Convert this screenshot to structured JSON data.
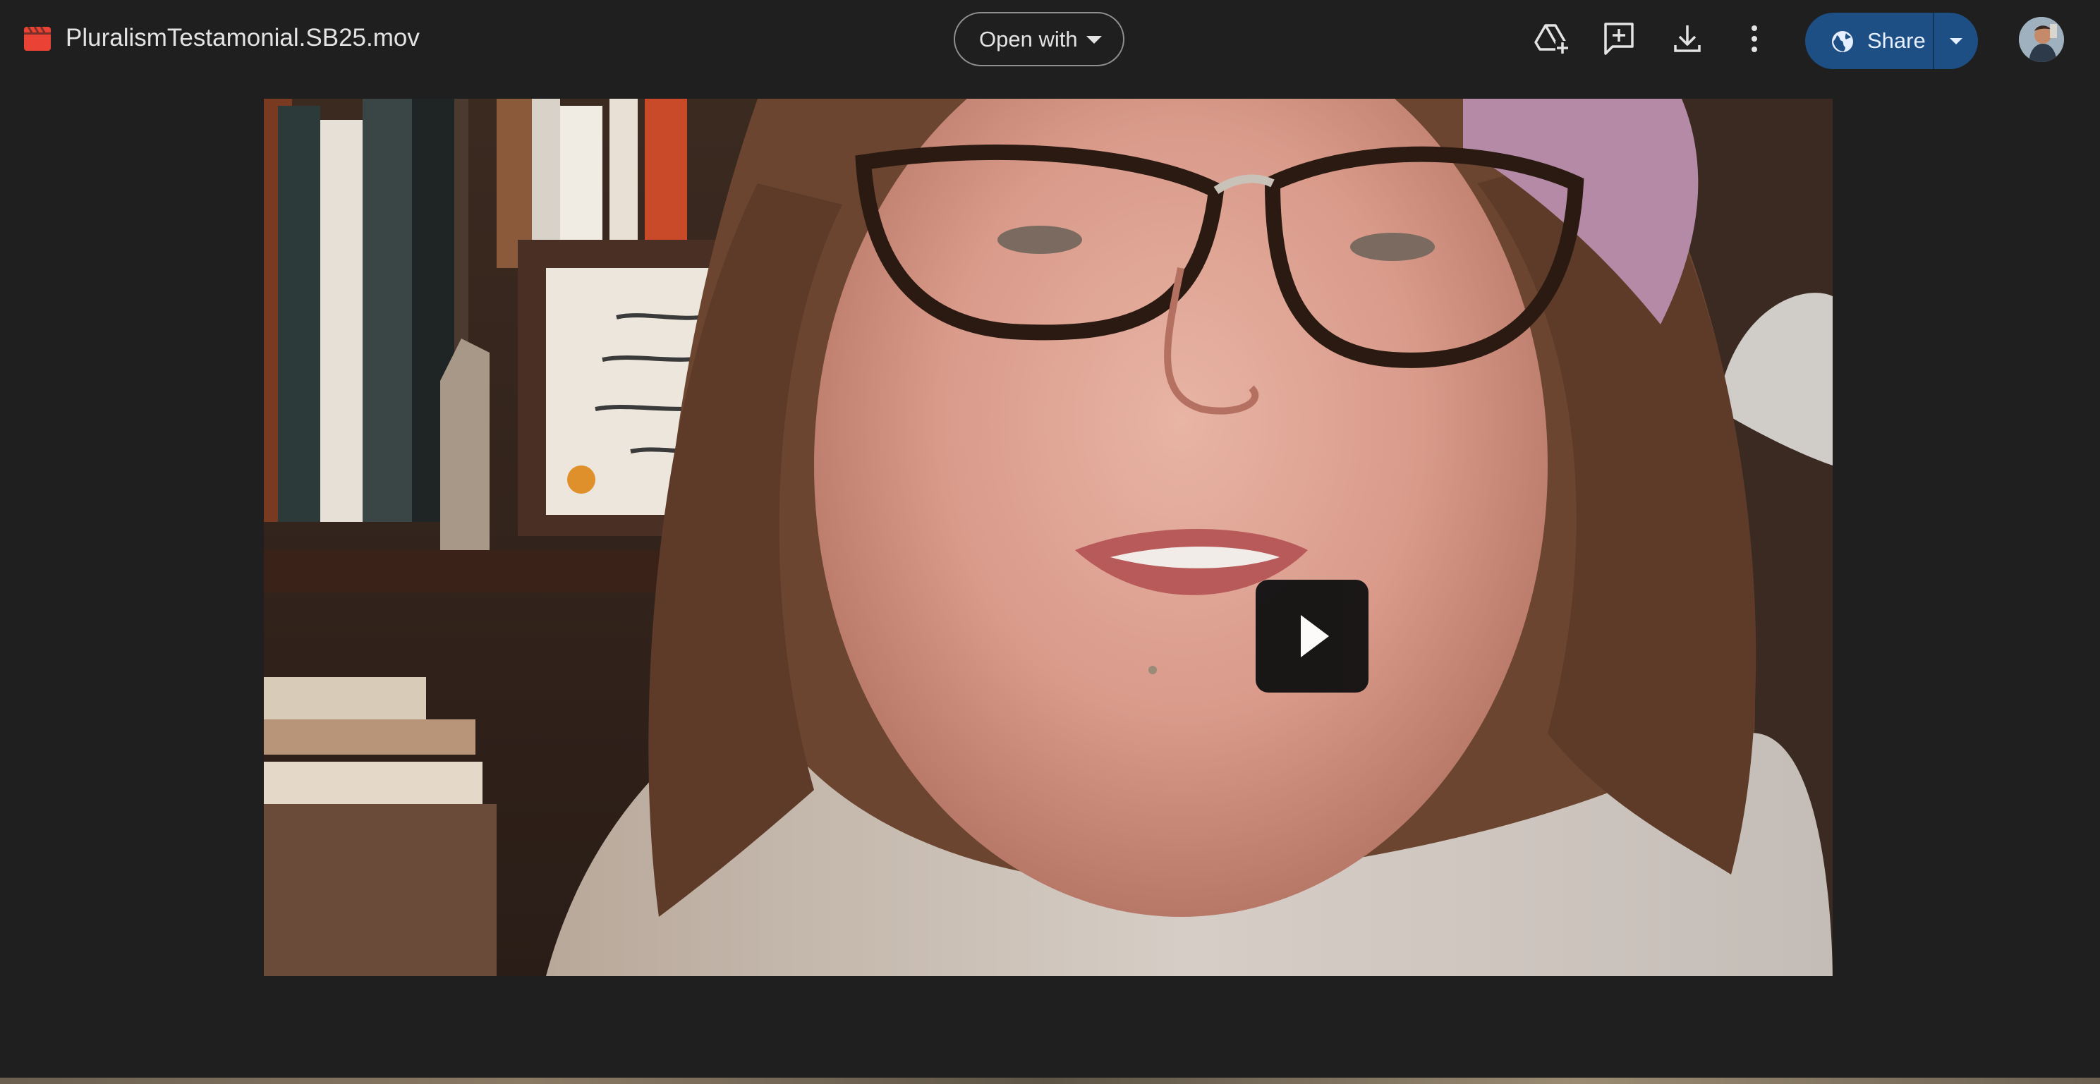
{
  "header": {
    "file_name": "PluralismTestamonial.SB25.mov",
    "file_type_icon": "video-file-icon",
    "open_with_label": "Open with",
    "actions": [
      {
        "name": "add-shortcut-to-drive",
        "icon": "drive-add-icon"
      },
      {
        "name": "add-comment",
        "icon": "add-comment-icon"
      },
      {
        "name": "download",
        "icon": "download-icon"
      },
      {
        "name": "more-actions",
        "icon": "more-vert-icon"
      }
    ],
    "share_label": "Share",
    "share_icon": "globe-icon"
  },
  "player": {
    "play_icon": "play-icon"
  },
  "colors": {
    "background": "#1f1f1f",
    "text": "#e3e3e3",
    "share_button": "#1d4e84",
    "file_icon": "#ea4335"
  }
}
